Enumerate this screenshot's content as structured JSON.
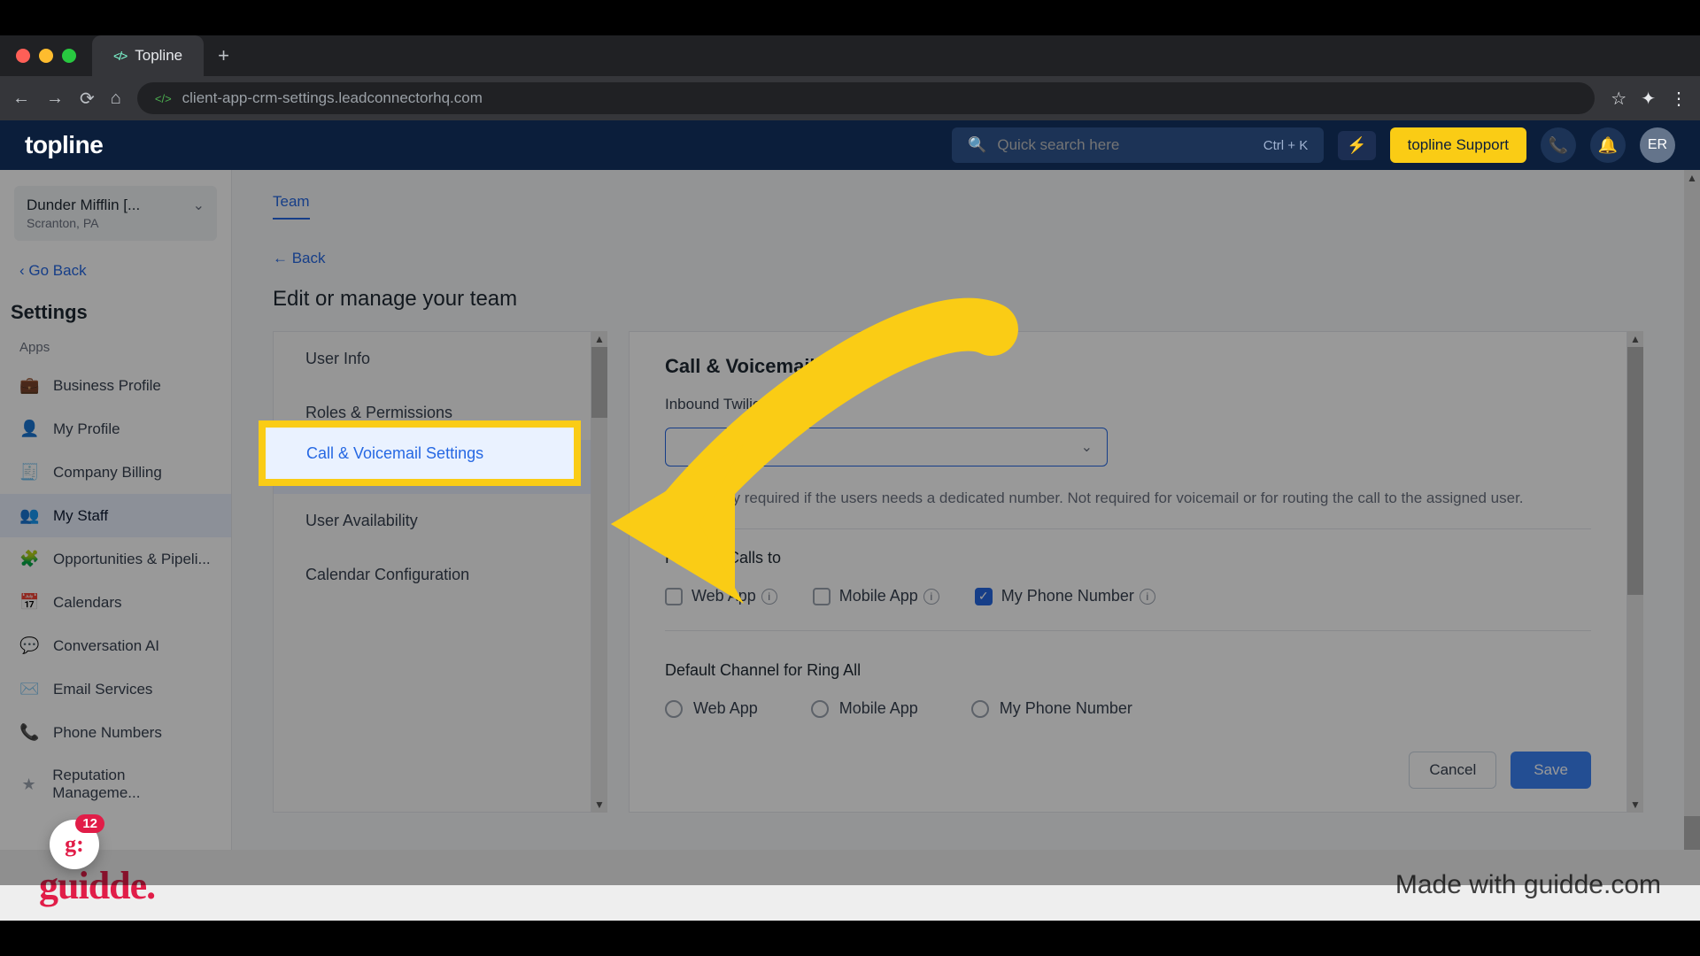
{
  "browser": {
    "tab_title": "Topline",
    "url": "client-app-crm-settings.leadconnectorhq.com",
    "newtab": "+"
  },
  "appbar": {
    "logo": "topline",
    "search_placeholder": "Quick search here",
    "shortcut": "Ctrl + K",
    "support": "topline Support",
    "avatar": "ER"
  },
  "sidebar": {
    "org": "Dunder Mifflin [...",
    "org_sub": "Scranton, PA",
    "goback": "Go Back",
    "section": "Settings",
    "group": "Apps",
    "items": [
      {
        "icon": "💼",
        "label": "Business Profile"
      },
      {
        "icon": "👤",
        "label": "My Profile"
      },
      {
        "icon": "🧾",
        "label": "Company Billing"
      },
      {
        "icon": "👥",
        "label": "My Staff"
      },
      {
        "icon": "🧩",
        "label": "Opportunities & Pipeli..."
      },
      {
        "icon": "📅",
        "label": "Calendars"
      },
      {
        "icon": "💬",
        "label": "Conversation AI"
      },
      {
        "icon": "✉️",
        "label": "Email Services"
      },
      {
        "icon": "📞",
        "label": "Phone Numbers"
      },
      {
        "icon": "★",
        "label": "Reputation Manageme..."
      }
    ],
    "bubble_badge": "12",
    "bubble_text": "g:"
  },
  "main": {
    "tab": "Team",
    "back": "←  Back",
    "title": "Edit or manage your team",
    "leftnav": [
      "User Info",
      "Roles & Permissions",
      "Call & Voicemail Settings",
      "User Availability",
      "Calendar Configuration"
    ],
    "highlighted": "Call & Voicemail Settings",
    "panel": {
      "heading": "Call & Voicemail Settings",
      "field_label": "Inbound Twilio Number",
      "help": "This is only required if the users needs a dedicated number. Not required for voicemail or for routing the call to the assigned user.",
      "forward_label": "Forward Calls to",
      "forward_opts": [
        "Web App",
        "Mobile App",
        "My Phone Number"
      ],
      "default_label": "Default Channel for Ring All",
      "default_opts": [
        "Web App",
        "Mobile App",
        "My Phone Number"
      ],
      "cancel": "Cancel",
      "save": "Save"
    }
  },
  "footer": {
    "brand": "guidde.",
    "credit": "Made with guidde.com"
  }
}
